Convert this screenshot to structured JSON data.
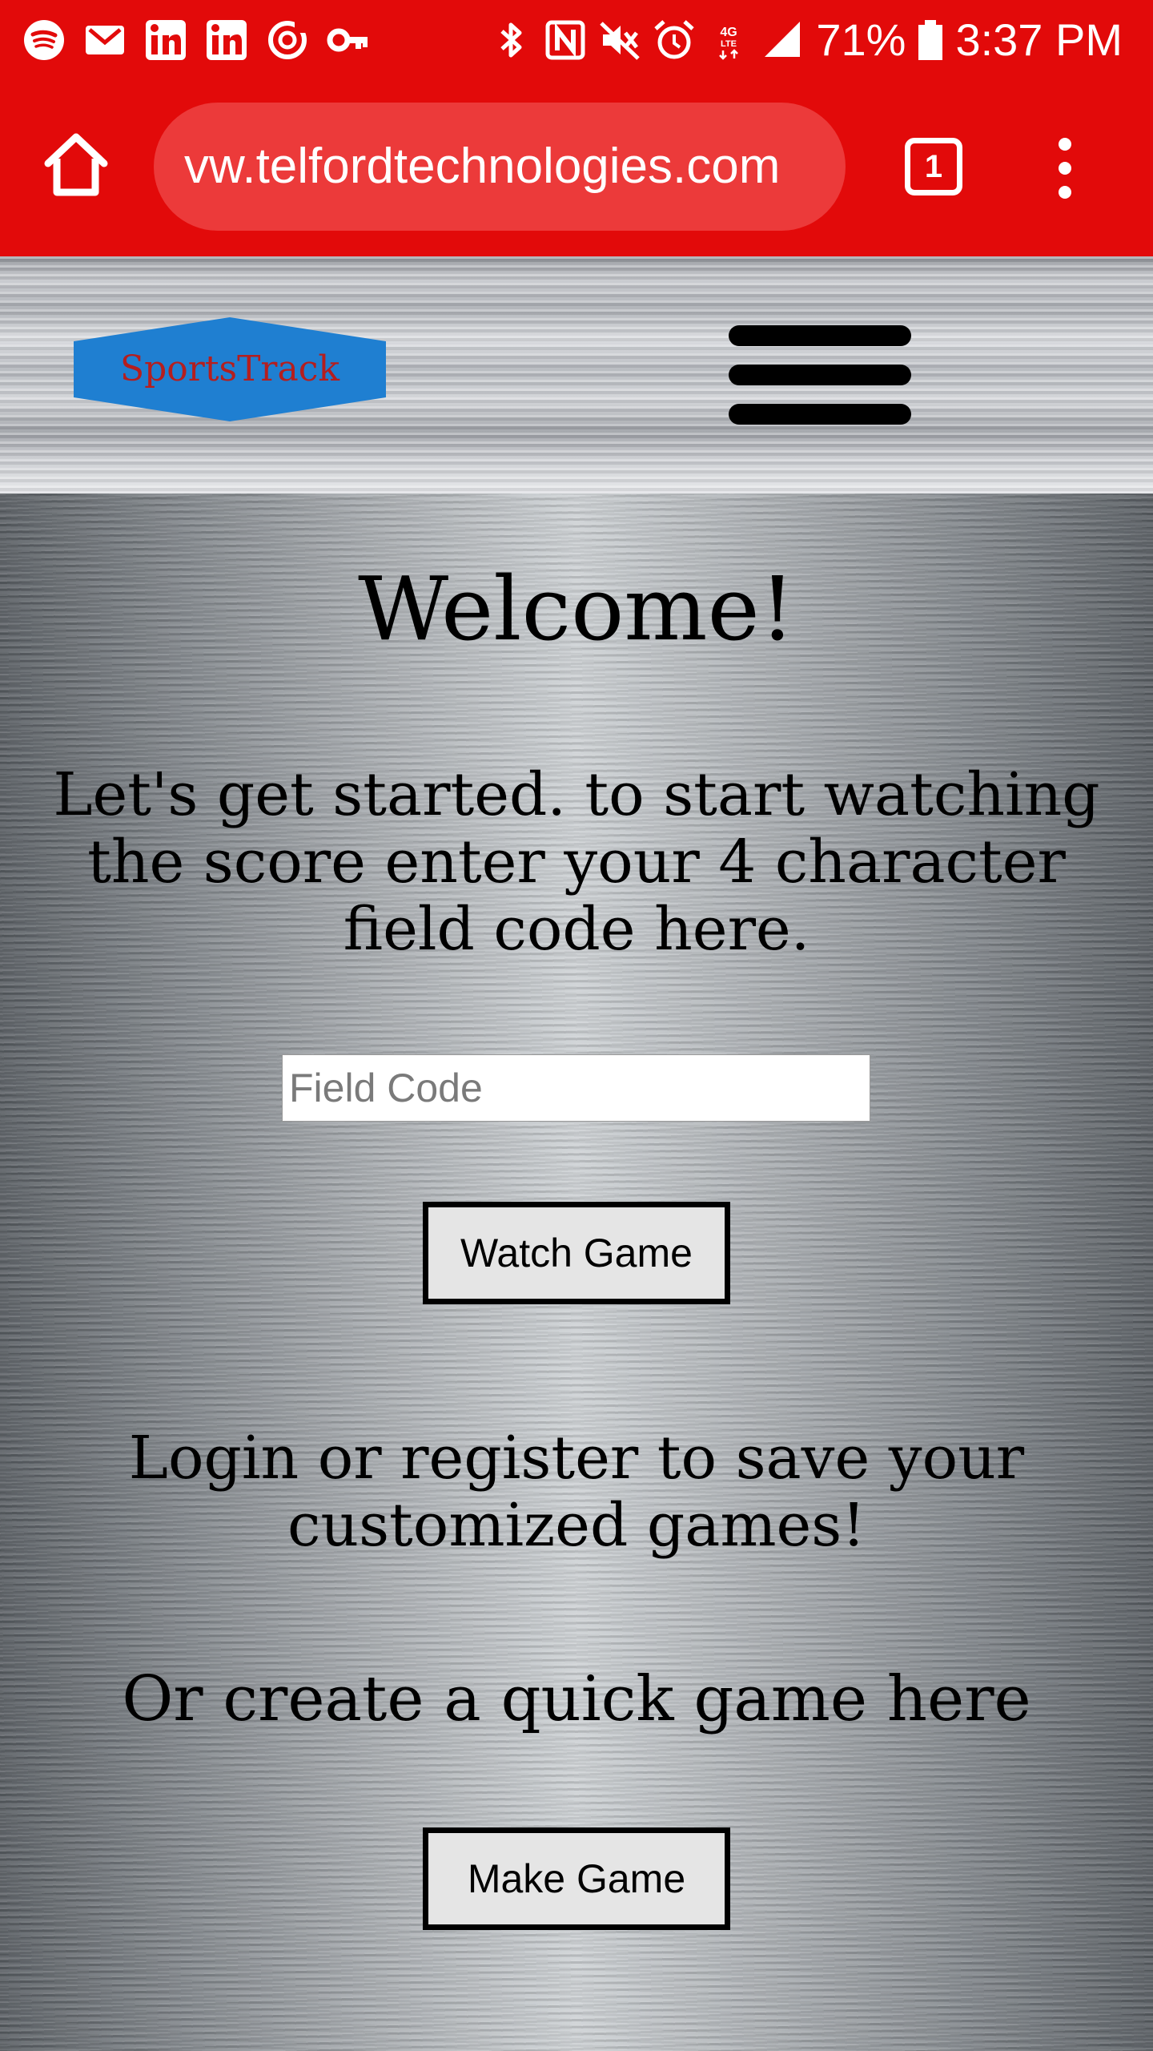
{
  "status_bar": {
    "left_icons": [
      "spotify-icon",
      "mail-icon",
      "linkedin-icon",
      "linkedin-icon",
      "sync-icon",
      "key-icon"
    ],
    "right_icons": [
      "bluetooth-icon",
      "nfc-icon",
      "mute-icon",
      "alarm-icon",
      "lte-icon",
      "signal-icon"
    ],
    "battery_percent": "71%",
    "battery_icon": "battery-icon",
    "time": "3:37 PM"
  },
  "browser": {
    "url": "vw.telfordtechnologies.com",
    "tab_count": "1",
    "home_icon": "home-icon",
    "menu_icon": "more-vert-icon"
  },
  "header": {
    "logo_text": "SportsTrack",
    "menu_icon": "hamburger-icon"
  },
  "main": {
    "welcome": "Welcome!",
    "intro": "Let's get started. to start watching the score enter your 4 character field code here.",
    "field_code_placeholder": "Field Code",
    "watch_button": "Watch Game",
    "login_text": "Login or register to save your customized games!",
    "quick_text": "Or create a quick game here",
    "make_button": "Make Game"
  },
  "colors": {
    "browser_red": "#e20a0a",
    "logo_blue": "#1f7fd1",
    "logo_text": "#b51e1e"
  }
}
